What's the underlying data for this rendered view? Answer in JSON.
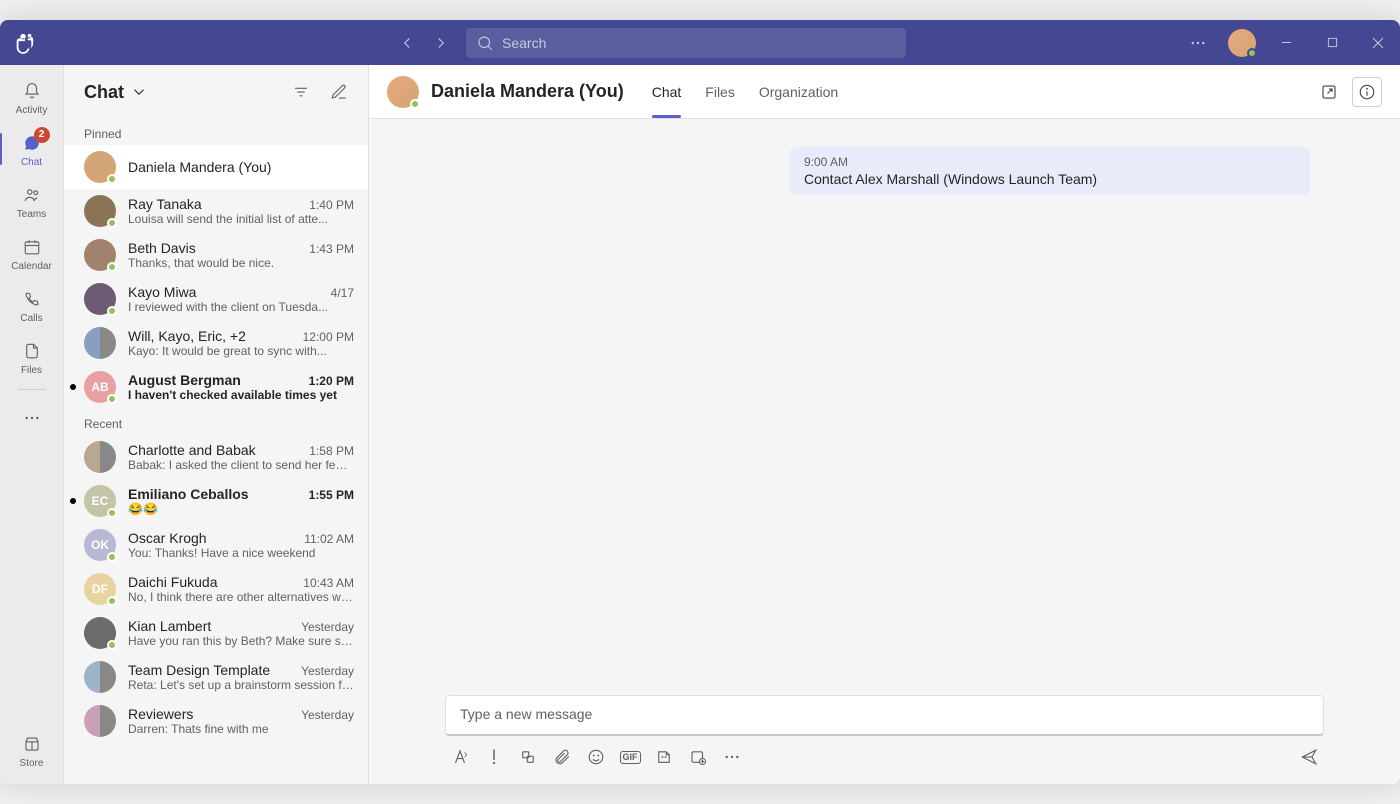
{
  "titlebar": {
    "search_placeholder": "Search"
  },
  "rail": {
    "items": [
      {
        "label": "Activity"
      },
      {
        "label": "Chat",
        "badge": "2"
      },
      {
        "label": "Teams"
      },
      {
        "label": "Calendar"
      },
      {
        "label": "Calls"
      },
      {
        "label": "Files"
      }
    ],
    "store_label": "Store"
  },
  "chat_list": {
    "title": "Chat",
    "sections": {
      "pinned": "Pinned",
      "recent": "Recent"
    },
    "pinned": [
      {
        "name": "Daniela Mandera (You)",
        "time": "",
        "preview": "",
        "unread": false,
        "selected": true,
        "avatar": "img",
        "color": "#d4a574"
      },
      {
        "name": "Ray Tanaka",
        "time": "1:40 PM",
        "preview": "Louisa will send the initial list of atte...",
        "unread": false,
        "avatar": "img",
        "color": "#8b7355"
      },
      {
        "name": "Beth Davis",
        "time": "1:43 PM",
        "preview": "Thanks, that would be nice.",
        "unread": false,
        "avatar": "img",
        "color": "#a0826d"
      },
      {
        "name": "Kayo Miwa",
        "time": "4/17",
        "preview": "I reviewed with the client on Tuesda...",
        "unread": false,
        "avatar": "img",
        "color": "#6b5b73"
      },
      {
        "name": "Will, Kayo, Eric, +2",
        "time": "12:00 PM",
        "preview": "Kayo: It would be great to sync with...",
        "unread": false,
        "avatar": "duo",
        "color": "#8b9dc3"
      },
      {
        "name": "August Bergman",
        "time": "1:20 PM",
        "preview": "I haven't checked available times yet",
        "unread": true,
        "avatar": "initials",
        "initials": "AB",
        "color": "#e8a0a0"
      }
    ],
    "recent": [
      {
        "name": "Charlotte and Babak",
        "time": "1:58 PM",
        "preview": "Babak: I asked the client to send her feed...",
        "unread": false,
        "avatar": "duo",
        "color": "#b8a890"
      },
      {
        "name": "Emiliano Ceballos",
        "time": "1:55 PM",
        "preview": "😂😂",
        "unread": true,
        "avatar": "initials",
        "initials": "EC",
        "color": "#c4c4a8"
      },
      {
        "name": "Oscar Krogh",
        "time": "11:02 AM",
        "preview": "You: Thanks! Have a nice weekend",
        "unread": false,
        "avatar": "initials",
        "initials": "OK",
        "color": "#b8b8d4"
      },
      {
        "name": "Daichi Fukuda",
        "time": "10:43 AM",
        "preview": "No, I think there are other alternatives we c...",
        "unread": false,
        "avatar": "initials",
        "initials": "DF",
        "color": "#e8d4a0"
      },
      {
        "name": "Kian Lambert",
        "time": "Yesterday",
        "preview": "Have you ran this by Beth? Make sure she is...",
        "unread": false,
        "avatar": "img",
        "color": "#6b6b6b"
      },
      {
        "name": "Team Design Template",
        "time": "Yesterday",
        "preview": "Reta: Let's set up a brainstorm session for...",
        "unread": false,
        "avatar": "duo",
        "color": "#9db3c8"
      },
      {
        "name": "Reviewers",
        "time": "Yesterday",
        "preview": "Darren: Thats fine with me",
        "unread": false,
        "avatar": "duo",
        "color": "#c8a0b8"
      }
    ]
  },
  "conversation": {
    "title": "Daniela Mandera (You)",
    "tabs": [
      "Chat",
      "Files",
      "Organization"
    ],
    "active_tab": 0,
    "messages": [
      {
        "time": "9:00 AM",
        "text": "Contact Alex Marshall (Windows Launch Team)"
      }
    ],
    "compose_placeholder": "Type a new message"
  }
}
